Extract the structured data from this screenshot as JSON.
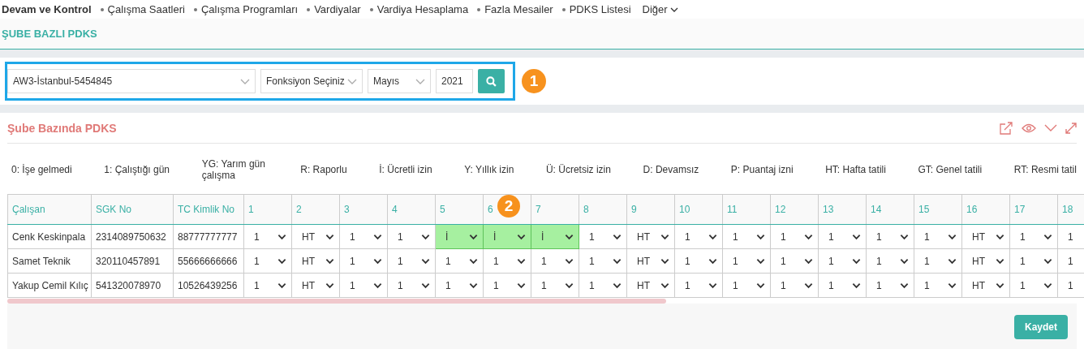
{
  "nav": {
    "title": "Devam ve Kontrol",
    "items": [
      "Çalışma Saatleri",
      "Çalışma Programları",
      "Vardiyalar",
      "Vardiya Hesaplama",
      "Fazla Mesailer",
      "PDKS Listesi"
    ],
    "more": "Diğer"
  },
  "page_title": "ŞUBE BAZLI PDKS",
  "filters": {
    "branch": "AW3-İstanbul-5454845",
    "function": "Fonksiyon Seçiniz",
    "month": "Mayıs",
    "year": "2021"
  },
  "callouts": [
    "1",
    "2"
  ],
  "panel": {
    "title": "Şube Bazında PDKS",
    "legend": [
      "0: İşe gelmedi",
      "1: Çalıştığı gün",
      "YG: Yarım gün çalışma",
      "R: Raporlu",
      "İ: Ücretli izin",
      "Y: Yıllık izin",
      "Ü: Ücretsiz izin",
      "D: Devamsız",
      "P: Puantaj izni",
      "HT: Hafta tatili",
      "GT: Genel tatili",
      "RT: Resmi tatil"
    ],
    "columns": [
      "Çalışan",
      "SGK No",
      "TC Kimlik No",
      "1",
      "2",
      "3",
      "4",
      "5",
      "6",
      "7",
      "8",
      "9",
      "10",
      "11",
      "12",
      "13",
      "14",
      "15",
      "16",
      "17",
      "18"
    ],
    "rows": [
      {
        "name": "Cenk Keskinpala",
        "sgk": "2314089750632",
        "tc": "88777777777",
        "days": [
          {
            "value": "1",
            "highlighted": false
          },
          {
            "value": "HT",
            "highlighted": false
          },
          {
            "value": "1",
            "highlighted": false
          },
          {
            "value": "1",
            "highlighted": false
          },
          {
            "value": "İ",
            "highlighted": true
          },
          {
            "value": "İ",
            "highlighted": true
          },
          {
            "value": "İ",
            "highlighted": true
          },
          {
            "value": "1",
            "highlighted": false
          },
          {
            "value": "HT",
            "highlighted": false
          },
          {
            "value": "1",
            "highlighted": false
          },
          {
            "value": "1",
            "highlighted": false
          },
          {
            "value": "1",
            "highlighted": false
          },
          {
            "value": "1",
            "highlighted": false
          },
          {
            "value": "1",
            "highlighted": false
          },
          {
            "value": "1",
            "highlighted": false
          },
          {
            "value": "HT",
            "highlighted": false
          },
          {
            "value": "1",
            "highlighted": false
          },
          {
            "value": "1",
            "highlighted": false
          }
        ]
      },
      {
        "name": "Samet Teknik",
        "sgk": "320110457891",
        "tc": "55666666666",
        "days": [
          {
            "value": "1",
            "highlighted": false
          },
          {
            "value": "HT",
            "highlighted": false
          },
          {
            "value": "1",
            "highlighted": false
          },
          {
            "value": "1",
            "highlighted": false
          },
          {
            "value": "1",
            "highlighted": false
          },
          {
            "value": "1",
            "highlighted": false
          },
          {
            "value": "1",
            "highlighted": false
          },
          {
            "value": "1",
            "highlighted": false
          },
          {
            "value": "HT",
            "highlighted": false
          },
          {
            "value": "1",
            "highlighted": false
          },
          {
            "value": "1",
            "highlighted": false
          },
          {
            "value": "1",
            "highlighted": false
          },
          {
            "value": "1",
            "highlighted": false
          },
          {
            "value": "1",
            "highlighted": false
          },
          {
            "value": "1",
            "highlighted": false
          },
          {
            "value": "HT",
            "highlighted": false
          },
          {
            "value": "1",
            "highlighted": false
          },
          {
            "value": "1",
            "highlighted": false
          }
        ]
      },
      {
        "name": "Yakup Cemil Kılıç",
        "sgk": "541320078970",
        "tc": "10526439256",
        "days": [
          {
            "value": "1",
            "highlighted": false
          },
          {
            "value": "HT",
            "highlighted": false
          },
          {
            "value": "1",
            "highlighted": false
          },
          {
            "value": "1",
            "highlighted": false
          },
          {
            "value": "1",
            "highlighted": false
          },
          {
            "value": "1",
            "highlighted": false
          },
          {
            "value": "1",
            "highlighted": false
          },
          {
            "value": "1",
            "highlighted": false
          },
          {
            "value": "HT",
            "highlighted": false
          },
          {
            "value": "1",
            "highlighted": false
          },
          {
            "value": "1",
            "highlighted": false
          },
          {
            "value": "1",
            "highlighted": false
          },
          {
            "value": "1",
            "highlighted": false
          },
          {
            "value": "1",
            "highlighted": false
          },
          {
            "value": "1",
            "highlighted": false
          },
          {
            "value": "HT",
            "highlighted": false
          },
          {
            "value": "1",
            "highlighted": false
          },
          {
            "value": "1",
            "highlighted": false
          }
        ]
      }
    ]
  },
  "save_button": "Kaydet"
}
